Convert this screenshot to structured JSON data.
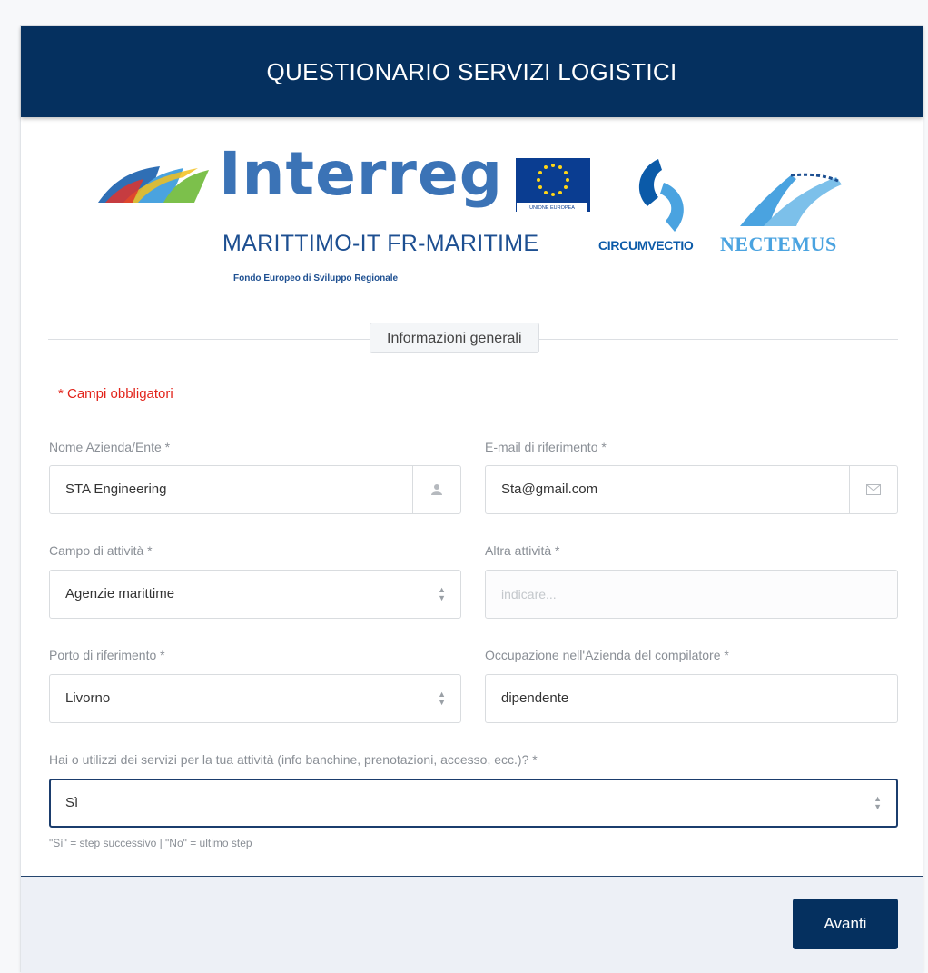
{
  "header": {
    "title": "QUESTIONARIO SERVIZI LOGISTICI"
  },
  "logos": {
    "interreg": "Interreg",
    "eu_caption": "UNIONE EUROPEA",
    "program": "MARITTIMO-IT FR-MARITIME",
    "fund": "Fondo Europeo di Sviluppo Regionale",
    "circumvectio": "CIRCUMVECTIO",
    "nectemus": "NECTEMUS"
  },
  "section": {
    "title": "Informazioni generali"
  },
  "required_note": "* Campi obbligatori",
  "form": {
    "company": {
      "label": "Nome Azienda/Ente *",
      "value": "STA Engineering",
      "icon": "user-icon"
    },
    "email": {
      "label": "E-mail di riferimento *",
      "value": "Sta@gmail.com",
      "icon": "envelope-icon"
    },
    "activity": {
      "label": "Campo di attività *",
      "value": "Agenzie marittime"
    },
    "other_activity": {
      "label": "Altra attività *",
      "placeholder": "indicare..."
    },
    "port": {
      "label": "Porto di riferimento *",
      "value": "Livorno"
    },
    "occupation": {
      "label": "Occupazione nell'Azienda del compilatore *",
      "value": "dipendente"
    },
    "services": {
      "label": "Hai o utilizzi dei servizi per la tua attività (info banchine, prenotazioni, accesso, ecc.)? *",
      "value": "Sì",
      "hint": "\"Sì\" = step successivo | \"No\" = ultimo step"
    }
  },
  "footer": {
    "next_label": "Avanti"
  },
  "colors": {
    "primary": "#05305f",
    "required": "#e2231a",
    "interreg_blue": "#3b73b6"
  }
}
